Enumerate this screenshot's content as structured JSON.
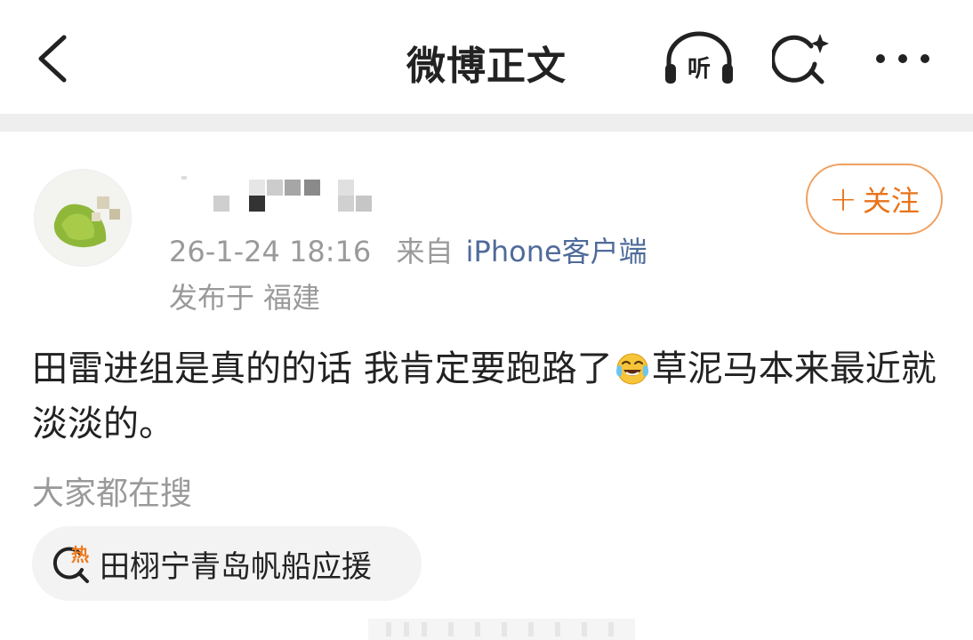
{
  "header": {
    "title": "微博正文",
    "listen_label": "听"
  },
  "post": {
    "follow_label": "关注",
    "timestamp": "26-1-24 18:16",
    "source_prefix": "来自",
    "source": "iPhone客户端",
    "location": "发布于 福建",
    "text_part1": "田雷进组是真的的话 我肯定要跑路了",
    "text_part2": "草泥马本来最近就淡淡的。",
    "emoji": "crying-laughing-emoji"
  },
  "search": {
    "label": "大家都在搜",
    "hot_badge": "热",
    "hot_topic": "田栩宁青岛帆船应援"
  },
  "colors": {
    "accent_orange": "#e8731a",
    "source_blue": "#4f6b9a",
    "meta_gray": "#9a9a9a"
  }
}
